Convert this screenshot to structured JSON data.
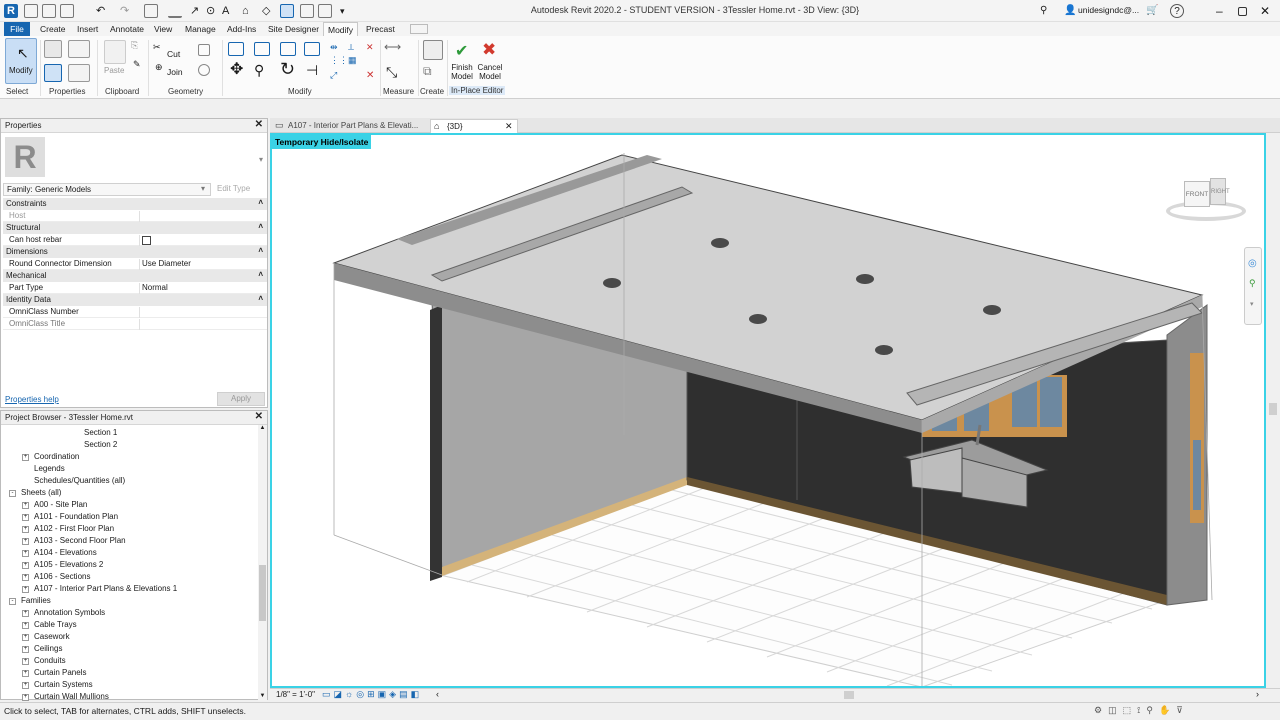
{
  "app": {
    "title": "Autodesk Revit 2020.2 - STUDENT VERSION - 3Tessler Home.rvt - 3D View: {3D}",
    "user": "unidesigndc@..."
  },
  "ribbon": {
    "tabs": [
      "File",
      "Create",
      "Insert",
      "Annotate",
      "View",
      "Manage",
      "Add-Ins",
      "Site Designer",
      "Modify",
      "Precast"
    ],
    "active_tab": "Modify",
    "buttons": {
      "modify": "Modify",
      "paste": "Paste",
      "cut": "Cut",
      "join": "Join",
      "measure": "Measure",
      "create": "Create",
      "finish": "Finish\nModel",
      "cancel": "Cancel\nModel"
    },
    "panels": {
      "select": "Select",
      "properties": "Properties",
      "clipboard": "Clipboard",
      "geometry": "Geometry",
      "modify": "Modify",
      "measure": "Measure",
      "create": "Create",
      "inplace": "In-Place Editor"
    }
  },
  "properties": {
    "title": "Properties",
    "family": "Family: Generic Models",
    "edit_type": "Edit Type",
    "groups": [
      {
        "name": "Constraints",
        "rows": [
          {
            "k": "Host",
            "v": ""
          }
        ]
      },
      {
        "name": "Structural",
        "rows": [
          {
            "k": "Can host rebar",
            "v": ""
          }
        ]
      },
      {
        "name": "Dimensions",
        "rows": [
          {
            "k": "Round Connector Dimension",
            "v": "Use Diameter"
          }
        ]
      },
      {
        "name": "Mechanical",
        "rows": [
          {
            "k": "Part Type",
            "v": "Normal"
          }
        ]
      },
      {
        "name": "Identity Data",
        "rows": [
          {
            "k": "OmniClass Number",
            "v": ""
          },
          {
            "k": "OmniClass Title",
            "v": ""
          }
        ]
      }
    ],
    "help": "Properties help",
    "apply": "Apply"
  },
  "browser": {
    "title": "Project Browser - 3Tessler Home.rvt",
    "items": [
      {
        "label": "Section 1",
        "indent": 3
      },
      {
        "label": "Section 2",
        "indent": 3
      },
      {
        "label": "Coordination",
        "indent": 1,
        "exp": "+"
      },
      {
        "label": "Legends",
        "indent": 1
      },
      {
        "label": "Schedules/Quantities (all)",
        "indent": 1
      },
      {
        "label": "Sheets (all)",
        "indent": 0,
        "exp": "-"
      },
      {
        "label": "A00 - Site Plan",
        "indent": 1,
        "exp": "+"
      },
      {
        "label": "A101 - Foundation Plan",
        "indent": 1,
        "exp": "+"
      },
      {
        "label": "A102 - First Floor Plan",
        "indent": 1,
        "exp": "+"
      },
      {
        "label": "A103 - Second Floor Plan",
        "indent": 1,
        "exp": "+"
      },
      {
        "label": "A104 - Elevations",
        "indent": 1,
        "exp": "+"
      },
      {
        "label": "A105 - Elevations 2",
        "indent": 1,
        "exp": "+"
      },
      {
        "label": "A106 - Sections",
        "indent": 1,
        "exp": "+"
      },
      {
        "label": "A107 - Interior Part Plans & Elevations 1",
        "indent": 1,
        "exp": "+"
      },
      {
        "label": "Families",
        "indent": 0,
        "exp": "-"
      },
      {
        "label": "Annotation Symbols",
        "indent": 1,
        "exp": "+"
      },
      {
        "label": "Cable Trays",
        "indent": 1,
        "exp": "+"
      },
      {
        "label": "Casework",
        "indent": 1,
        "exp": "+"
      },
      {
        "label": "Ceilings",
        "indent": 1,
        "exp": "+"
      },
      {
        "label": "Conduits",
        "indent": 1,
        "exp": "+"
      },
      {
        "label": "Curtain Panels",
        "indent": 1,
        "exp": "+"
      },
      {
        "label": "Curtain Systems",
        "indent": 1,
        "exp": "+"
      },
      {
        "label": "Curtain Wall Mullions",
        "indent": 1,
        "exp": "+"
      }
    ]
  },
  "views": {
    "tabs": [
      "A107 - Interior Part Plans & Elevati...",
      "{3D}"
    ],
    "badge": "Temporary Hide/Isolate",
    "viewcube": {
      "front": "FRONT",
      "right": "RIGHT"
    },
    "scale": "1/8\" = 1'-0\""
  },
  "status": "Click to select, TAB for alternates, CTRL adds, SHIFT unselects.",
  "colors": {
    "accent": "#3ad2e6",
    "file_tab": "#1766b0"
  }
}
